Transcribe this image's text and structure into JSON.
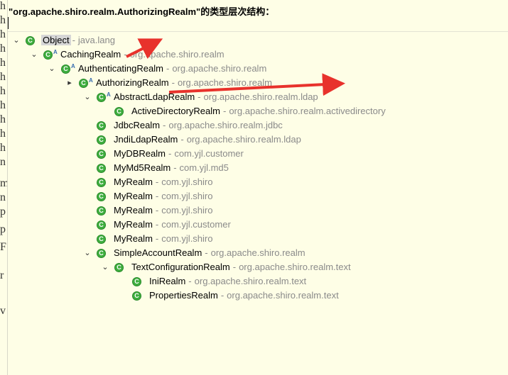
{
  "header": {
    "title": "\"org.apache.shiro.realm.AuthorizingRealm\"的类型层次结构："
  },
  "left_strip_chars": [
    "h",
    "h",
    "h",
    "h",
    "h",
    "h",
    "h",
    "h",
    "h",
    "h",
    "h",
    "n",
    "m",
    "n",
    "p",
    "p",
    "F",
    "r",
    "v"
  ],
  "sep": "-",
  "tree": [
    {
      "name": "Object",
      "pkg": "java.lang",
      "depth": 0,
      "toggle": "v",
      "abstract": false,
      "selected": true
    },
    {
      "name": "CachingRealm",
      "pkg": "org.apache.shiro.realm",
      "depth": 1,
      "toggle": "v",
      "abstract": true
    },
    {
      "name": "AuthenticatingRealm",
      "pkg": "org.apache.shiro.realm",
      "depth": 2,
      "toggle": "v",
      "abstract": true
    },
    {
      "name": "AuthorizingRealm",
      "pkg": "org.apache.shiro.realm",
      "depth": 3,
      "toggle": ">",
      "abstract": true
    },
    {
      "name": "AbstractLdapRealm",
      "pkg": "org.apache.shiro.realm.ldap",
      "depth": 4,
      "toggle": "v",
      "abstract": true
    },
    {
      "name": "ActiveDirectoryRealm",
      "pkg": "org.apache.shiro.realm.activedirectory",
      "depth": 5,
      "toggle": "",
      "abstract": false
    },
    {
      "name": "JdbcRealm",
      "pkg": "org.apache.shiro.realm.jdbc",
      "depth": 4,
      "toggle": "",
      "abstract": false
    },
    {
      "name": "JndiLdapRealm",
      "pkg": "org.apache.shiro.realm.ldap",
      "depth": 4,
      "toggle": "",
      "abstract": false
    },
    {
      "name": "MyDBRealm",
      "pkg": "com.yjl.customer",
      "depth": 4,
      "toggle": "",
      "abstract": false
    },
    {
      "name": "MyMd5Realm",
      "pkg": "com.yjl.md5",
      "depth": 4,
      "toggle": "",
      "abstract": false
    },
    {
      "name": "MyRealm",
      "pkg": "com.yjl.shiro",
      "depth": 4,
      "toggle": "",
      "abstract": false
    },
    {
      "name": "MyRealm",
      "pkg": "com.yjl.shiro",
      "depth": 4,
      "toggle": "",
      "abstract": false
    },
    {
      "name": "MyRealm",
      "pkg": "com.yjl.shiro",
      "depth": 4,
      "toggle": "",
      "abstract": false
    },
    {
      "name": "MyRealm",
      "pkg": "com.yjl.customer",
      "depth": 4,
      "toggle": "",
      "abstract": false
    },
    {
      "name": "MyRealm",
      "pkg": "com.yjl.shiro",
      "depth": 4,
      "toggle": "",
      "abstract": false
    },
    {
      "name": "SimpleAccountRealm",
      "pkg": "org.apache.shiro.realm",
      "depth": 4,
      "toggle": "v",
      "abstract": false
    },
    {
      "name": "TextConfigurationRealm",
      "pkg": "org.apache.shiro.realm.text",
      "depth": 5,
      "toggle": "v",
      "abstract": false
    },
    {
      "name": "IniRealm",
      "pkg": "org.apache.shiro.realm.text",
      "depth": 6,
      "toggle": "",
      "abstract": false
    },
    {
      "name": "PropertiesRealm",
      "pkg": "org.apache.shiro.realm.text",
      "depth": 6,
      "toggle": "",
      "abstract": false
    }
  ],
  "icons": {
    "class": "class-icon",
    "abstract": "abstract-marker",
    "expand": "chevron-down-icon",
    "collapse": "chevron-right-icon"
  },
  "colors": {
    "background": "#fefee6",
    "class_icon": "#3fae3f",
    "package_text": "#8a8a8a",
    "annotation_arrow": "#e8322c",
    "selection": "#d6d6d6"
  }
}
